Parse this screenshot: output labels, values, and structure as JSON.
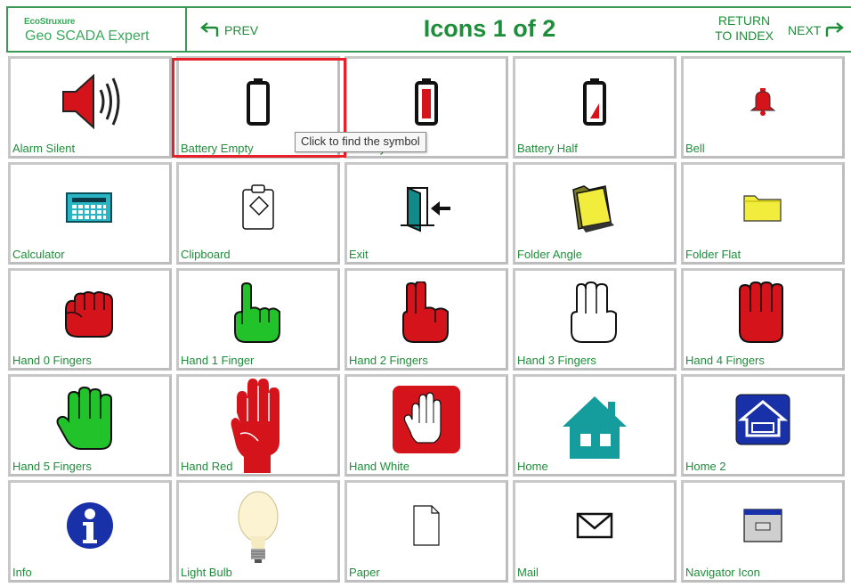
{
  "header": {
    "logo_brand": "EcoStruxure",
    "logo_product": "Geo SCADA Expert",
    "prev_label": "PREV",
    "title": "Icons 1 of 2",
    "return_label": "RETURN TO INDEX",
    "next_label": "NEXT"
  },
  "tooltip": "Click to find the symbol",
  "accent_color": "#1f8e3a",
  "selection_color": "#e8202a",
  "cells": [
    {
      "label": "Alarm Silent",
      "icon": "alarm-silent-icon"
    },
    {
      "label": "Battery Empty",
      "icon": "battery-empty-icon"
    },
    {
      "label": "Battery Full",
      "icon": "battery-full-icon"
    },
    {
      "label": "Battery Half",
      "icon": "battery-half-icon"
    },
    {
      "label": "Bell",
      "icon": "bell-icon"
    },
    {
      "label": "Calculator",
      "icon": "calculator-icon"
    },
    {
      "label": "Clipboard",
      "icon": "clipboard-icon"
    },
    {
      "label": "Exit",
      "icon": "exit-icon"
    },
    {
      "label": "Folder Angle",
      "icon": "folder-angle-icon"
    },
    {
      "label": "Folder Flat",
      "icon": "folder-flat-icon"
    },
    {
      "label": "Hand 0 Fingers",
      "icon": "hand-0-fingers-icon"
    },
    {
      "label": "Hand 1 Finger",
      "icon": "hand-1-finger-icon"
    },
    {
      "label": "Hand 2 Fingers",
      "icon": "hand-2-fingers-icon"
    },
    {
      "label": "Hand 3 Fingers",
      "icon": "hand-3-fingers-icon"
    },
    {
      "label": "Hand 4 Fingers",
      "icon": "hand-4-fingers-icon"
    },
    {
      "label": "Hand 5 Fingers",
      "icon": "hand-5-fingers-icon"
    },
    {
      "label": "Hand Red",
      "icon": "hand-red-icon"
    },
    {
      "label": "Hand White",
      "icon": "hand-white-icon"
    },
    {
      "label": "Home",
      "icon": "home-icon"
    },
    {
      "label": "Home 2",
      "icon": "home-2-icon"
    },
    {
      "label": "Info",
      "icon": "info-icon"
    },
    {
      "label": "Light Bulb",
      "icon": "light-bulb-icon"
    },
    {
      "label": "Paper",
      "icon": "paper-icon"
    },
    {
      "label": "Mail",
      "icon": "mail-icon"
    },
    {
      "label": "Navigator Icon",
      "icon": "navigator-icon"
    }
  ]
}
